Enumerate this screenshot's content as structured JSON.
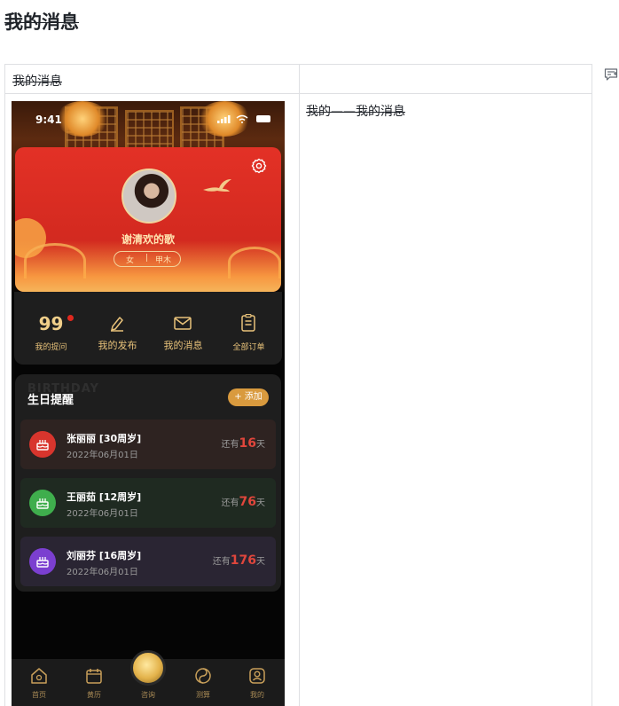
{
  "doc": {
    "title": "我的消息",
    "table": {
      "header_left": "我的消息",
      "header_right": "",
      "description": "我的——我的消息"
    }
  },
  "phone": {
    "status_time": "9:41",
    "profile": {
      "name": "谢清欢的歌",
      "gender": "女",
      "separator": "|",
      "element": "甲木"
    },
    "stats": [
      {
        "value": "99",
        "label": "我的提问"
      },
      {
        "label": "我的发布"
      },
      {
        "label": "我的消息"
      },
      {
        "label": "全部订单"
      }
    ],
    "birthday": {
      "title": "生日提醒",
      "watermark": "BIRTHDAY",
      "add_label": "+ 添加",
      "items": [
        {
          "name": "张丽丽 [30周岁]",
          "date": "2022年06月01日",
          "prefix": "还有",
          "days": "16",
          "suffix": "天",
          "icon_color": "#d8352d",
          "row_color": "#2e2321"
        },
        {
          "name": "王丽茹 [12周岁]",
          "date": "2022年06月01日",
          "prefix": "还有",
          "days": "76",
          "suffix": "天",
          "icon_color": "#3fae4d",
          "row_color": "#1f2a21"
        },
        {
          "name": "刘丽芬 [16周岁]",
          "date": "2022年06月01日",
          "prefix": "还有",
          "days": "176",
          "suffix": "天",
          "icon_color": "#7b3fd0",
          "row_color": "#2a2533"
        }
      ]
    },
    "tabs": [
      {
        "label": "首页",
        "icon": "home-icon"
      },
      {
        "label": "黄历",
        "icon": "calendar-icon"
      },
      {
        "label": "咨询",
        "icon": "orb-icon"
      },
      {
        "label": "测算",
        "icon": "taiji-icon"
      },
      {
        "label": "我的",
        "icon": "profile-icon"
      }
    ]
  },
  "colors": {
    "accent_gold": "#e8c27a",
    "card_red": "#e33126",
    "days_red": "#e0463c"
  }
}
